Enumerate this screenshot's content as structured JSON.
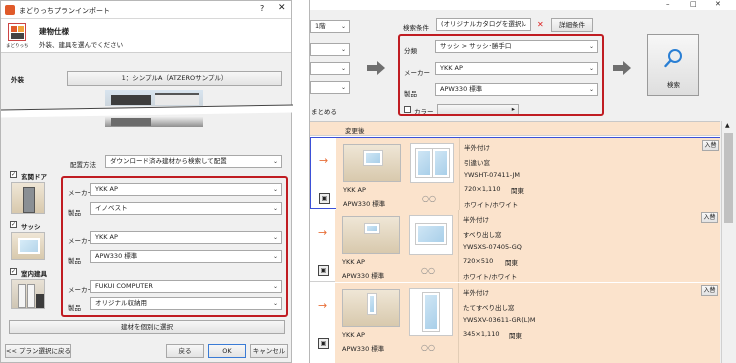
{
  "left": {
    "title": "まどりっちプランインポート",
    "header_icon_label": "まどりっち",
    "header_title": "建物仕様",
    "header_subtitle": "外装、建具を選んでください",
    "exterior_label": "外装",
    "exterior_value": "1：シンプルA（ATZEROサンプル）",
    "placement_label": "配置方法",
    "placement_value": "ダウンロード済み建材から検索して配置",
    "sections": [
      {
        "label": "玄関ドア",
        "maker_label": "メーカー",
        "maker": "YKK AP",
        "product_label": "製品",
        "product": "イノベスト"
      },
      {
        "label": "サッシ",
        "maker_label": "メーカー",
        "maker": "YKK AP",
        "product_label": "製品",
        "product": "APW330 標準"
      },
      {
        "label": "室内建具",
        "maker_label": "メーカー",
        "maker": "FUKUI COMPUTER",
        "product_label": "製品",
        "product": "オリジナル収納用"
      }
    ],
    "individual_button": "建材を個別に選択",
    "back_plan_button": "<< プラン選択に戻る",
    "back_button": "戻る",
    "ok_button": "OK",
    "cancel_button": "キャンセル"
  },
  "right": {
    "floor": "1階",
    "search_condition_label": "検索条件",
    "search_condition_value": "(オリジナルカタログを選択)",
    "detail_button": "詳細条件",
    "category_label": "分類",
    "category_value": "サッシ > サッシ･勝手口",
    "maker_label": "メーカー",
    "maker_value": "YKK AP",
    "product_label": "製品",
    "product_value": "APW330 標準",
    "color_label": "カラー",
    "search_button": "検索",
    "summarize_label": "まとめる",
    "column_header": "変更後",
    "results": [
      {
        "maker": "YKK AP",
        "product": "APW330 標準",
        "install": "半外付け",
        "type": "引違い窓",
        "code": "YWSHT-07411-JM",
        "size": "720×1,110",
        "glass": "関東",
        "color": "ホワイト/ホワイト",
        "replace": "入替"
      },
      {
        "maker": "YKK AP",
        "product": "APW330 標準",
        "install": "半外付け",
        "type": "すべり出し窓",
        "code": "YWSXS-07405-GQ",
        "size": "720×510",
        "glass": "関東",
        "color": "ホワイト/ホワイト",
        "replace": "入替"
      },
      {
        "maker": "YKK AP",
        "product": "APW330 標準",
        "install": "半外付け",
        "type": "たてすべり出し窓",
        "code": "YWSXV-03611-GR(L)M",
        "size": "345×1,110",
        "glass": "関東",
        "color": "",
        "replace": "入替"
      }
    ]
  },
  "colors": {
    "accent_red": "#c01c22",
    "row_orange": "#fbe3cc",
    "arrow_orange": "#e8703a",
    "search_blue": "#2a7fd4"
  }
}
